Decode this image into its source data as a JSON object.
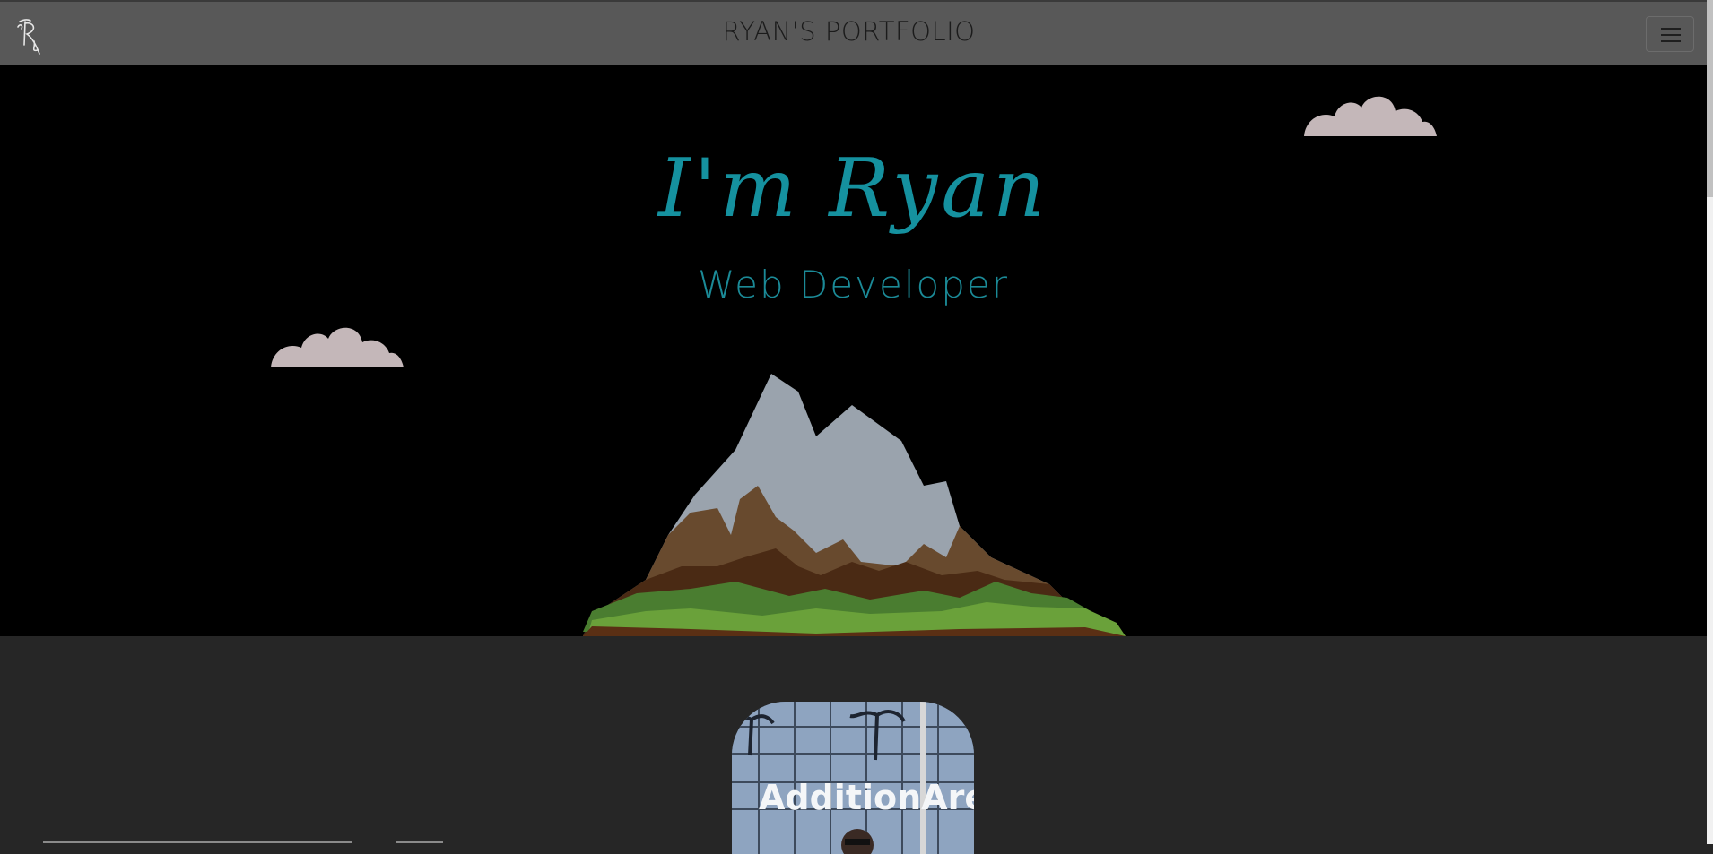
{
  "navbar": {
    "brand": "RYAN'S PORTFOLIO",
    "logo_icon": "r-monogram-logo-icon",
    "menu_icon": "hamburger-menu-icon"
  },
  "hero": {
    "title": "I'm Ryan",
    "subtitle": "Web Developer"
  },
  "about": {
    "photo_caption": "AdditionAre"
  },
  "colors": {
    "navbar_bg": "#585858",
    "hero_bg": "#000000",
    "accent": "#15919f",
    "section_bg": "#262626",
    "cloud": "#c4b7b9"
  }
}
